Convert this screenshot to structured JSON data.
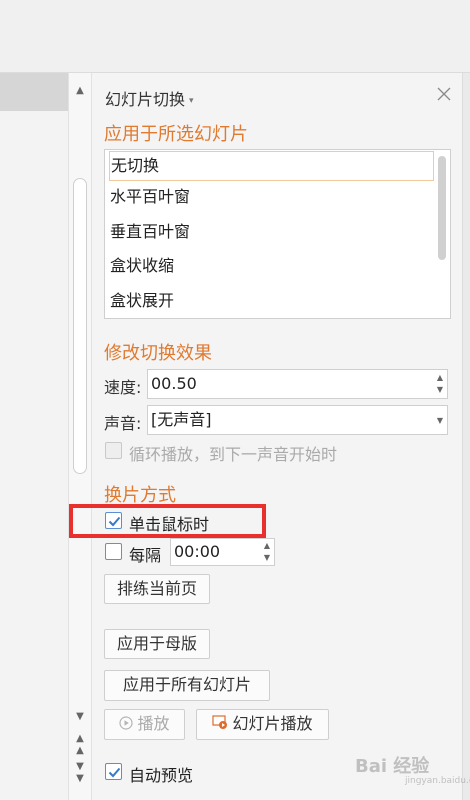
{
  "panel": {
    "title": "幻灯片切换",
    "title_caret": "▾"
  },
  "apply_section": {
    "title": "应用于所选幻灯片",
    "transitions": [
      "无切换",
      "水平百叶窗",
      "垂直百叶窗",
      "盒状收缩",
      "盒状展开"
    ],
    "selected_index": 0
  },
  "modify_section": {
    "title": "修改切换效果",
    "speed_label": "速度:",
    "speed_value": "00.50",
    "sound_label": "声音:",
    "sound_value": "[无声音]",
    "loop_label": "循环播放，到下一声音开始时",
    "loop_checked": false
  },
  "advance_section": {
    "title": "换片方式",
    "on_click_label": "单击鼠标时",
    "on_click_checked": true,
    "every_label": "每隔",
    "every_checked": false,
    "every_value": "00:00",
    "rehearse_label": "排练当前页"
  },
  "buttons": {
    "apply_master": "应用于母版",
    "apply_all": "应用于所有幻灯片",
    "play": "播放",
    "slideshow": "幻灯片播放"
  },
  "auto_preview": {
    "label": "自动预览",
    "checked": true
  },
  "watermark": {
    "text": "Bai 经验",
    "sub": "jingyan.baidu.com"
  },
  "colors": {
    "section_title": "#e07a30",
    "highlight_box": "#e8312f",
    "checkbox_check": "#3a78c9"
  }
}
